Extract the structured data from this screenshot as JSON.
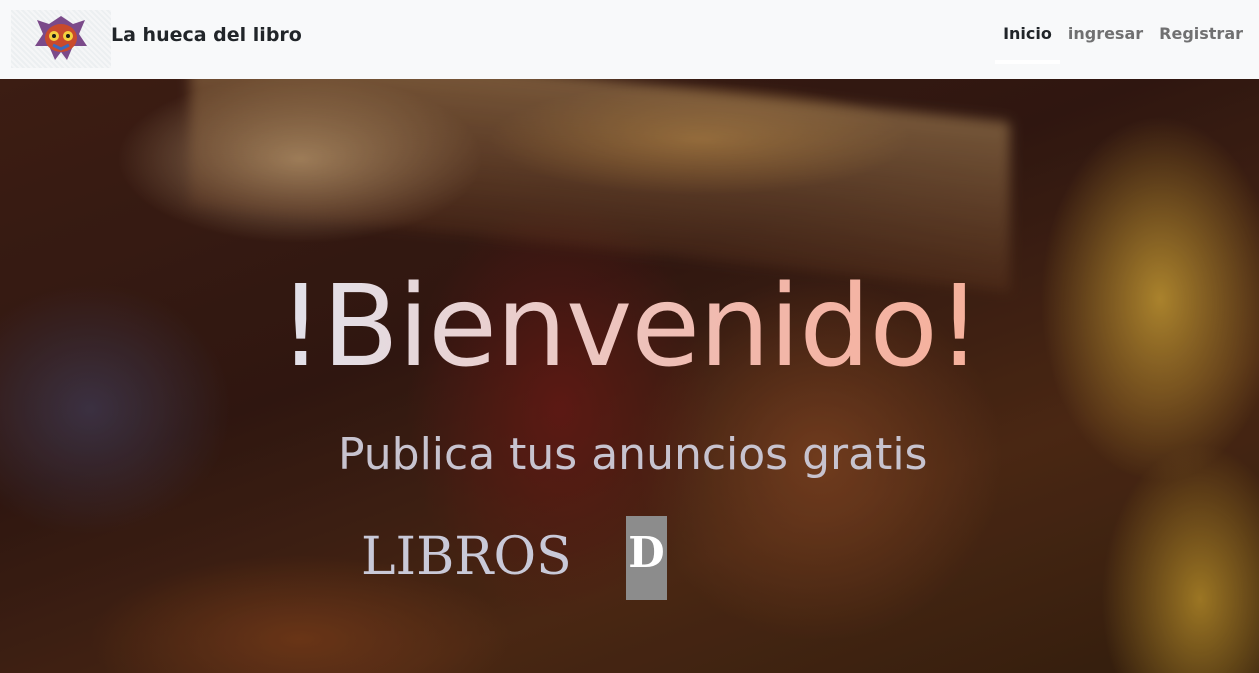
{
  "navbar": {
    "logo_icon": "majoras-mask-logo",
    "brand": "La hueca del libro",
    "links": [
      {
        "label": "Inicio",
        "active": true
      },
      {
        "label": "ingresar",
        "active": false
      },
      {
        "label": "Registrar",
        "active": false
      }
    ]
  },
  "hero": {
    "title": "!Bienvenido!",
    "subtitle": "Publica tus anuncios gratis",
    "typed_word": "LIBROS",
    "typing_letter": "D",
    "background": "books-photo"
  },
  "colors": {
    "navbar_bg": "#f8f9fa",
    "brand_text": "#212529",
    "nav_inactive": "#757575",
    "typing_box": "#8c8c8c"
  }
}
